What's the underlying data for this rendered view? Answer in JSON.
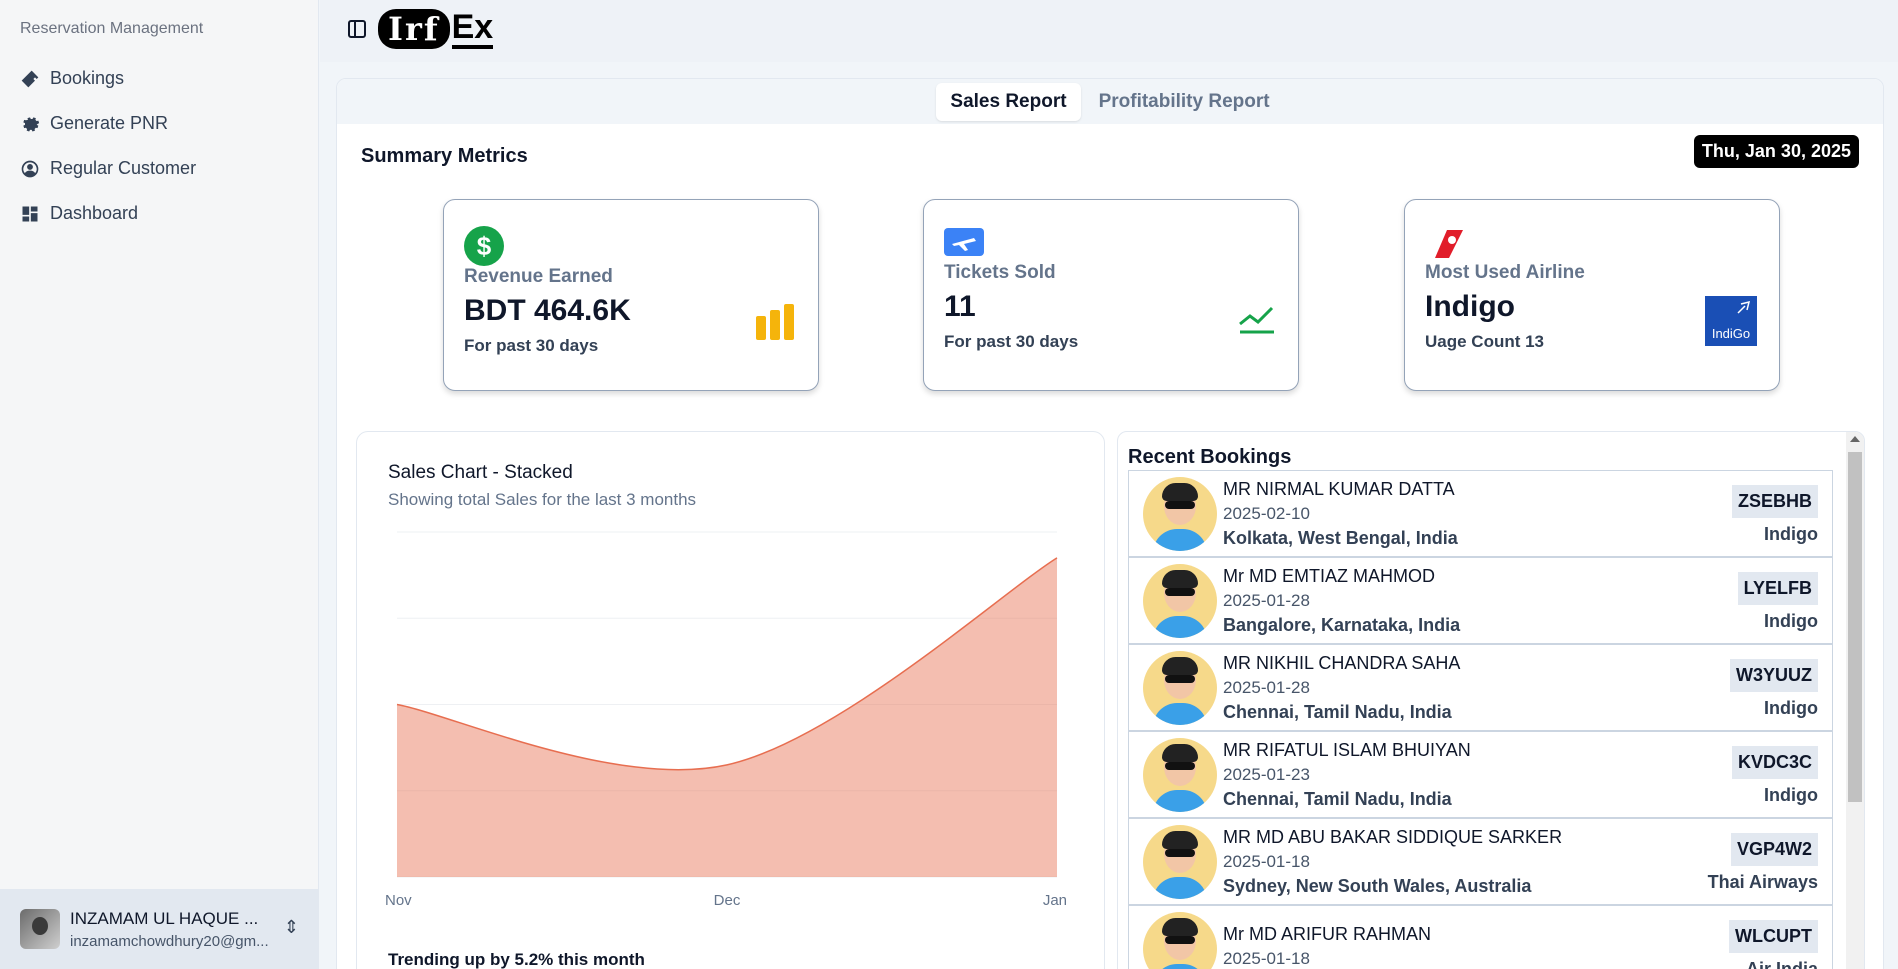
{
  "sidebar": {
    "group_label": "Reservation Management",
    "items": [
      {
        "label": "Bookings",
        "icon": "ticket-icon"
      },
      {
        "label": "Generate PNR",
        "icon": "gear-icon"
      },
      {
        "label": "Regular Customer",
        "icon": "user-circle-icon"
      },
      {
        "label": "Dashboard",
        "icon": "dashboard-icon"
      }
    ],
    "user": {
      "name": "INZAMAM UL HAQUE ...",
      "email": "inzamamchowdhury20@gm..."
    }
  },
  "header": {
    "logo_main": "Irf",
    "logo_tail": "Ex"
  },
  "tabs": [
    {
      "label": "Sales Report",
      "active": true
    },
    {
      "label": "Profitability Report",
      "active": false
    }
  ],
  "summary": {
    "title": "Summary Metrics",
    "date": "Thu, Jan 30, 2025",
    "cards": [
      {
        "label": "Revenue Earned",
        "value": "BDT 464.6K",
        "sub": "For past 30 days",
        "icon": "dollar-icon",
        "side_icon": "coin-stack-icon"
      },
      {
        "label": "Tickets Sold",
        "value": "11",
        "sub": "For past 30 days",
        "icon": "plane-ticket-icon",
        "side_icon": "trend-up-icon"
      },
      {
        "label": "Most Used Airline",
        "value": "Indigo",
        "sub": "Uage Count 13",
        "icon": "airline-tail-icon",
        "side_icon": "indigo-logo",
        "side_logo_text": "IndiGo"
      }
    ]
  },
  "chart": {
    "title": "Sales Chart - Stacked",
    "subtitle": "Showing total Sales for the last 3 months",
    "footer": "Trending up by 5.2% this month"
  },
  "chart_data": {
    "type": "area",
    "x": [
      "Nov",
      "Dec",
      "Jan"
    ],
    "series": [
      {
        "values": [
          200,
          130,
          370
        ]
      }
    ],
    "ylim": [
      0,
      400
    ],
    "grid": true,
    "color": "#e76e50"
  },
  "recent": {
    "title": "Recent Bookings",
    "bookings": [
      {
        "name": "MR NIRMAL KUMAR DATTA",
        "date": "2025-02-10",
        "location": "Kolkata, West Bengal, India",
        "pnr": "ZSEBHB",
        "airline": "Indigo"
      },
      {
        "name": "Mr MD EMTIAZ MAHMOD",
        "date": "2025-01-28",
        "location": "Bangalore, Karnataka, India",
        "pnr": "LYELFB",
        "airline": "Indigo"
      },
      {
        "name": "MR NIKHIL CHANDRA SAHA",
        "date": "2025-01-28",
        "location": "Chennai, Tamil Nadu, India",
        "pnr": "W3YUUZ",
        "airline": "Indigo"
      },
      {
        "name": "MR RIFATUL ISLAM BHUIYAN",
        "date": "2025-01-23",
        "location": "Chennai, Tamil Nadu, India",
        "pnr": "KVDC3C",
        "airline": "Indigo"
      },
      {
        "name": "MR MD ABU BAKAR SIDDIQUE SARKER",
        "date": "2025-01-18",
        "location": "Sydney, New South Wales, Australia",
        "pnr": "VGP4W2",
        "airline": "Thai Airways"
      },
      {
        "name": "Mr MD ARIFUR RAHMAN",
        "date": "2025-01-18",
        "location": "",
        "pnr": "WLCUPT",
        "airline": "Air India"
      }
    ]
  }
}
